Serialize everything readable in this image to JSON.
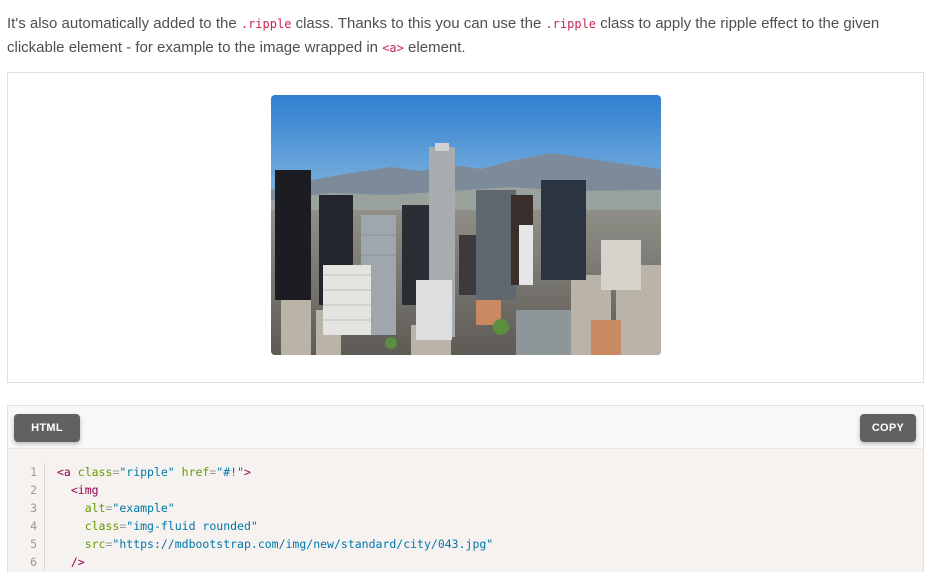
{
  "intro": {
    "text_1": "It's also automatically added to the ",
    "code_1": ".ripple",
    "text_2": " class. Thanks to this you can use the ",
    "code_2": ".ripple",
    "text_3": " class to apply the ripple effect to the given clickable element - for example to the image wrapped in ",
    "code_3": "<a>",
    "text_4": " element."
  },
  "demo": {
    "image_alt": "example",
    "image_subject": "city-skyline"
  },
  "code_toolbar": {
    "html_button": "HTML",
    "copy_button": "COPY"
  },
  "code": {
    "line_numbers": [
      "1",
      "2",
      "3",
      "4",
      "5",
      "6"
    ],
    "lines": [
      {
        "indent": "",
        "tag_open": "<a",
        "attr_1": " class",
        "eq_1": "=",
        "val_1": "\"ripple\"",
        "attr_2": " href",
        "eq_2": "=",
        "val_2": "\"#!\"",
        "tag_close": ">"
      },
      {
        "indent": "  ",
        "tag_open": "<img"
      },
      {
        "indent": "    ",
        "attr": "alt",
        "eq": "=",
        "val": "\"example\""
      },
      {
        "indent": "    ",
        "attr": "class",
        "eq": "=",
        "val": "\"img-fluid rounded\""
      },
      {
        "indent": "    ",
        "attr": "src",
        "eq": "=",
        "val": "\"https://mdbootstrap.com/img/new/standard/city/043.jpg\""
      },
      {
        "indent": "  ",
        "tag_close": "/>"
      }
    ]
  },
  "colors": {
    "button_bg": "#616161",
    "code_bg": "#f5f2f0",
    "inline_code": "#c7254e"
  }
}
